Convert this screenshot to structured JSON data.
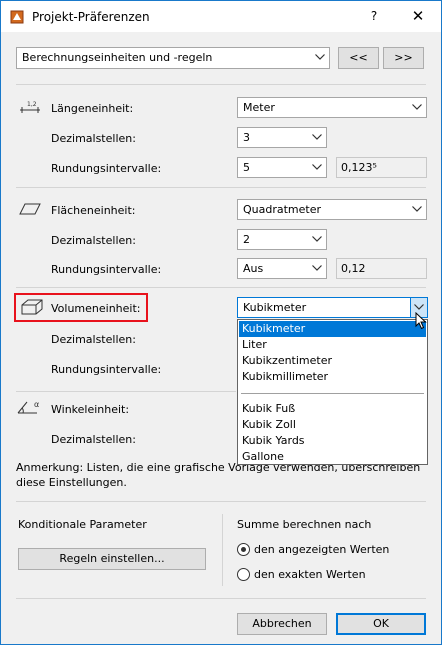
{
  "window": {
    "title": "Projekt-Präferenzen",
    "help_label": "?",
    "close_label": "✕"
  },
  "page_select": {
    "value": "Berechnungseinheiten und -regeln",
    "prev_label": "<<",
    "next_label": ">>"
  },
  "length": {
    "unit_label": "Längeneinheit:",
    "unit_value": "Meter",
    "decimals_label": "Dezimalstellen:",
    "decimals_value": "3",
    "rounding_label": "Rundungsintervalle:",
    "rounding_value": "5",
    "rounding_preview": "0,123⁵",
    "icon_text": "1,2"
  },
  "area": {
    "unit_label": "Flächeneinheit:",
    "unit_value": "Quadratmeter",
    "decimals_label": "Dezimalstellen:",
    "decimals_value": "2",
    "rounding_label": "Rundungsintervalle:",
    "rounding_value": "Aus",
    "rounding_preview": "0,12"
  },
  "volume": {
    "unit_label": "Volumeneinheit:",
    "unit_value": "Kubikmeter",
    "decimals_label": "Dezimalstellen:",
    "rounding_label": "Rundungsintervalle:",
    "options": [
      "Kubikmeter",
      "Liter",
      "Kubikzentimeter",
      "Kubikmillimeter",
      "Kubik Fuß",
      "Kubik Zoll",
      "Kubik Yards",
      "Gallone"
    ],
    "selected_option": "Kubikmeter"
  },
  "angle": {
    "unit_label": "Winkeleinheit:",
    "decimals_label": "Dezimalstellen:",
    "icon_text": "α"
  },
  "note": "Anmerkung: Listen, die eine grafische Vorlage verwenden, überschreiben diese Einstellungen.",
  "conditional": {
    "heading": "Konditionale Parameter",
    "rules_button": "Regeln einstellen..."
  },
  "sum": {
    "heading": "Summe berechnen nach",
    "option_displayed": "den angezeigten Werten",
    "option_exact": "den exakten Werten",
    "selected": "den angezeigten Werten"
  },
  "footer": {
    "cancel_label": "Abbrechen",
    "ok_label": "OK"
  },
  "colors": {
    "accent": "#0078d7",
    "highlight": "#e8121c"
  }
}
